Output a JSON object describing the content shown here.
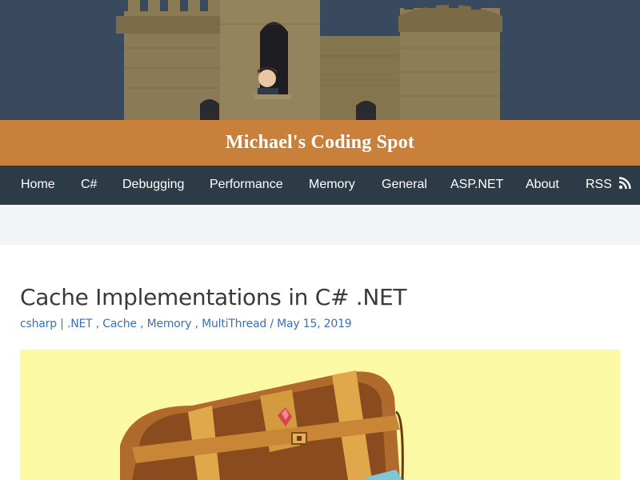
{
  "site": {
    "title": "Michael's Coding Spot"
  },
  "nav": {
    "items": [
      {
        "label": "Home"
      },
      {
        "label": "C#"
      },
      {
        "label": "Debugging"
      },
      {
        "label": "Performance"
      },
      {
        "label": "Memory"
      },
      {
        "label": "General"
      },
      {
        "label": "ASP.NET"
      },
      {
        "label": "About"
      },
      {
        "label": "RSS",
        "icon": "rss-icon"
      }
    ]
  },
  "post": {
    "title": "Cache Implementations in C# .NET",
    "author": "csharp",
    "author_separator": "|",
    "categories": [
      ".NET",
      "Cache",
      "Memory",
      "MultiThread"
    ],
    "category_separator": ",",
    "date_separator": "/",
    "date": "May 15, 2019"
  },
  "colors": {
    "title_bar": "#c8803a",
    "navbar": "#2d3b47",
    "link": "#3b6fb0",
    "hero_sky": "#3a4a5e",
    "featured_bg": "#fbf9a4"
  },
  "icons": {
    "hero": "castle-illustration",
    "featured": "treasure-chest-illustration"
  }
}
